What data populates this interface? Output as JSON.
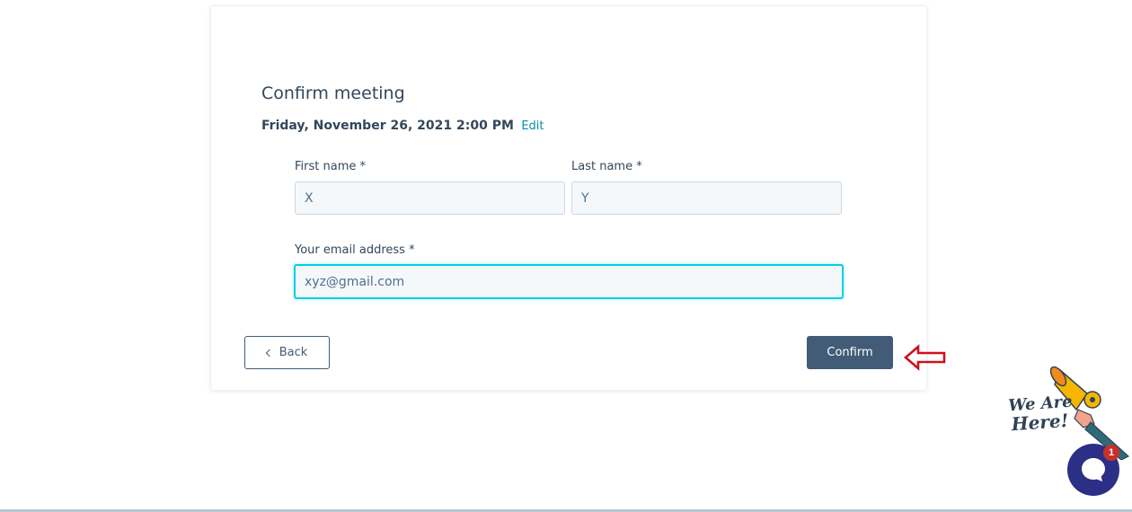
{
  "form": {
    "title": "Confirm meeting",
    "datetime": "Friday, November 26, 2021 2:00 PM",
    "edit_label": "Edit",
    "first_name": {
      "label": "First name *",
      "value": "X"
    },
    "last_name": {
      "label": "Last name *",
      "value": "Y"
    },
    "email": {
      "label": "Your email address *",
      "value": "xyz@gmail.com"
    },
    "back_label": "Back",
    "confirm_label": "Confirm"
  },
  "widget": {
    "tagline_line1": "We Are",
    "tagline_line2": "Here!",
    "unread_count": "1",
    "icons": [
      "megaphone-icon",
      "chat-bubble-icon"
    ]
  },
  "colors": {
    "primary_button": "#425b76",
    "link": "#0091ae",
    "focus_border": "#00d0e4",
    "annotation_arrow": "#d0101b",
    "chat_launcher": "#2c2f86",
    "badge": "#c9302c"
  },
  "annotation": {
    "icon": "arrow-left-outline-icon"
  }
}
